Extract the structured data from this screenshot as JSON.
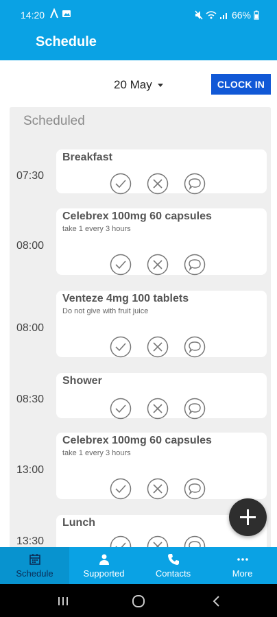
{
  "status_bar": {
    "time": "14:20",
    "battery": "66%"
  },
  "app_bar": {
    "title": "Schedule"
  },
  "date_picker": {
    "value": "20 May"
  },
  "clock_in": {
    "label": "CLOCK IN"
  },
  "schedule": {
    "section_title": "Scheduled",
    "entries": [
      {
        "time": "07:30",
        "title": "Breakfast",
        "subtitle": ""
      },
      {
        "time": "08:00",
        "title": "Celebrex 100mg 60 capsules",
        "subtitle": "take 1 every 3 hours"
      },
      {
        "time": "08:00",
        "title": "Venteze 4mg 100 tablets",
        "subtitle": "Do not give with fruit juice"
      },
      {
        "time": "08:30",
        "title": "Shower",
        "subtitle": ""
      },
      {
        "time": "13:00",
        "title": "Celebrex 100mg 60 capsules",
        "subtitle": "take 1 every 3 hours"
      },
      {
        "time": "13:30",
        "title": "Lunch",
        "subtitle": ""
      }
    ]
  },
  "bottom_nav": {
    "items": [
      {
        "label": "Schedule",
        "icon": "calendar-icon",
        "active": true
      },
      {
        "label": "Supported",
        "icon": "person-icon",
        "active": false
      },
      {
        "label": "Contacts",
        "icon": "phone-icon",
        "active": false
      },
      {
        "label": "More",
        "icon": "more-dots-icon",
        "active": false
      }
    ]
  },
  "colors": {
    "primary": "#0aa2e4",
    "button": "#1158d6",
    "fab": "#2e2e2e"
  }
}
